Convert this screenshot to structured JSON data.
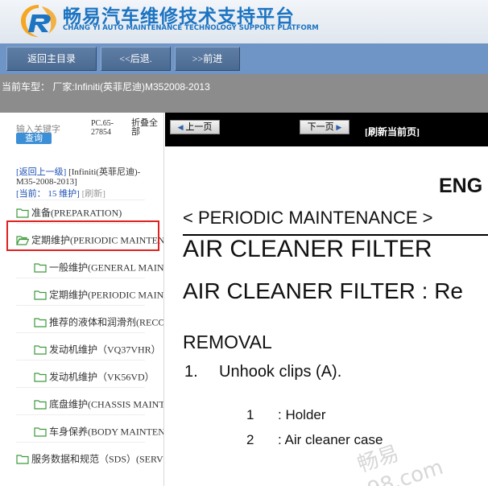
{
  "header": {
    "title_cn": "畅易汽车维修技术支持平台",
    "title_en": "CHANG YI AUTO MAINTENANCE TECHNOLOGY SUPPORT PLATFORM",
    "brand_colors": {
      "primary": "#1c74c2",
      "accent": "#f5a623"
    }
  },
  "toolbar": {
    "home_label": "返回主目录",
    "back_label": "<<后退.",
    "forward_label": ">>前进"
  },
  "vehicle": {
    "text": "当前车型：  厂家:Infiniti(英菲尼迪)M352008-2013"
  },
  "sidebar": {
    "keyword_label": "输入关键字",
    "query_label": "查询",
    "pc_code": "PC.65-27854",
    "fold_all": "折叠全部",
    "back_level_prefix": "[返回上一级]",
    "back_level_text": "[Infiniti(英菲尼迪)-M35-2008-2013]",
    "current_prefix": "[当前：",
    "current_value": "15",
    "current_suffix": "维护]",
    "refresh_label": "[刷新]",
    "tree": [
      {
        "label": "准备(PREPARATION)",
        "level": 0,
        "open": false
      },
      {
        "label": "定期维护(PERIODIC MAINTENANCE)",
        "level": 0,
        "open": true,
        "selected": true
      },
      {
        "label": "一般维护(GENERAL MAINTENANCE)",
        "level": 1,
        "open": false
      },
      {
        "label": "定期维护(PERIODIC MAINTENANCE)",
        "level": 1,
        "open": false
      },
      {
        "label": "推荐的液体和润滑剂(RECOMMENDED FLUIDS)",
        "level": 1,
        "open": false
      },
      {
        "label": "发动机维护（VQ37VHR）",
        "level": 1,
        "open": false
      },
      {
        "label": "发动机维护（VK56VD）",
        "level": 1,
        "open": false
      },
      {
        "label": "底盘维护(CHASSIS MAINTENANCE)",
        "level": 1,
        "open": false
      },
      {
        "label": "车身保养(BODY MAINTENANCE)",
        "level": 1,
        "open": false
      },
      {
        "label": "服务数据和规范（SDS）(SERVICE DATA)",
        "level": 0,
        "open": false
      }
    ]
  },
  "doc_nav": {
    "prev_label": "上一页",
    "next_label": "下一页",
    "refresh_label": "[刷新当前页]"
  },
  "document": {
    "engine_heading": "ENG",
    "section": "< PERIODIC MAINTENANCE >",
    "title": "AIR CLEANER FILTER",
    "subtitle": "AIR CLEANER FILTER : Re",
    "removal": "REMOVAL",
    "step1_num": "1.",
    "step1_text": "Unhook clips (A).",
    "legend": [
      {
        "num": "1",
        "text": ": Holder"
      },
      {
        "num": "2",
        "text": ": Air cleaner case"
      }
    ],
    "watermark_1": "畅易",
    "watermark_2": "98.com"
  }
}
